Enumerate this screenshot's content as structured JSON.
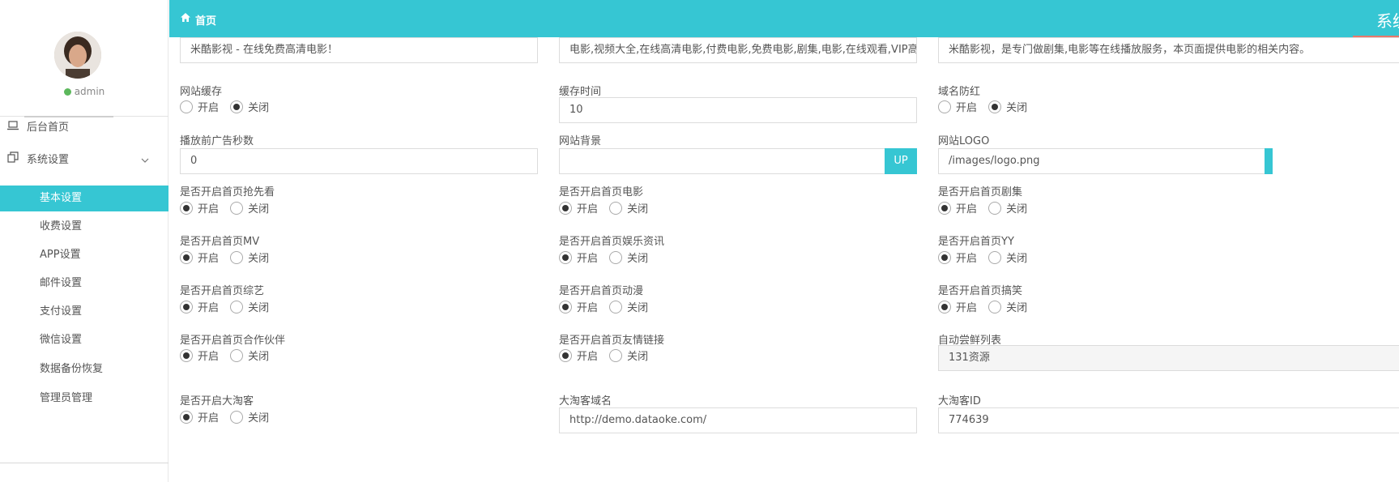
{
  "sidebar": {
    "user": "admin",
    "nav_home": "后台首页",
    "nav_settings": "系统设置",
    "sub_items": [
      "基本设置",
      "收费设置",
      "APP设置",
      "邮件设置",
      "支付设置",
      "微信设置",
      "数据备份恢复",
      "管理员管理"
    ],
    "active_index": 0
  },
  "topbar": {
    "title": "首页",
    "right_text": "系统"
  },
  "radio_labels": {
    "on": "开启",
    "off": "关闭"
  },
  "form": {
    "site_title_value": "米酷影视 - 在线免费高清电影！",
    "keywords_value": "电影,视频大全,在线高清电影,付费电影,免费电影,剧集,电影,在线观看,VIP高清电影",
    "description_value": "米酷影视，是专门做剧集,电影等在线播放服务，本页面提供电影的相关内容。",
    "cache_label": "网站缓存",
    "cache_time_label": "缓存时间",
    "cache_time_value": "10",
    "anti_red_label": "域名防红",
    "ad_seconds_label": "播放前广告秒数",
    "ad_seconds_value": "0",
    "bg_label": "网站背景",
    "bg_value": "",
    "up_label": "UP",
    "logo_label": "网站LOGO",
    "logo_value": "/images/logo.png",
    "preview_label": "是否开启首页抢先看",
    "movie_label": "是否开启首页电影",
    "series_label": "是否开启首页剧集",
    "mv_label": "是否开启首页MV",
    "ent_label": "是否开启首页娱乐资讯",
    "yy_label": "是否开启首页YY",
    "variety_label": "是否开启首页综艺",
    "anime_label": "是否开启首页动漫",
    "funny_label": "是否开启首页搞笑",
    "partner_label": "是否开启首页合作伙伴",
    "friend_label": "是否开启首页友情链接",
    "auto_label": "自动尝鲜列表",
    "auto_value": "131资源",
    "dtk_label": "是否开启大淘客",
    "dtk_domain_label": "大淘客域名",
    "dtk_domain_value": "http://demo.dataoke.com/",
    "dtk_id_label": "大淘客ID",
    "dtk_id_value": "774639"
  }
}
